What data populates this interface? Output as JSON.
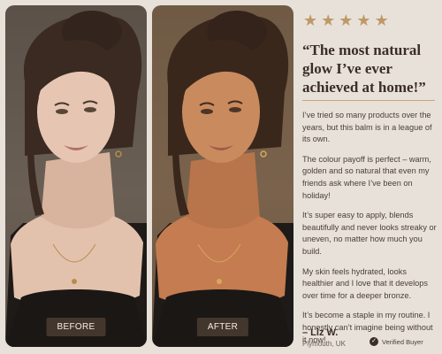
{
  "photos": {
    "before_label": "BEFORE",
    "after_label": "AFTER"
  },
  "review": {
    "rating": 5,
    "star_color": "#bf9867",
    "headline": "“The most natural glow I’ve ever achieved at home!”",
    "paragraphs": [
      "I’ve tried so many products over the years, but this balm is in a league of its own.",
      "The colour payoff is perfect – warm, golden and so natural that even my friends ask where I’ve been on holiday!",
      "It’s super easy to apply, blends beautifully and never looks streaky or uneven, no matter how much you build.",
      "My skin feels hydrated, looks healthier and I love that it develops over time for a deeper bronze.",
      "It’s become a staple in my routine. I honestly can’t imagine being without it now!"
    ],
    "reviewer_name": "– Liz W.",
    "reviewer_location": "Plymouth, UK",
    "verified_text": "Verified Buyer"
  }
}
